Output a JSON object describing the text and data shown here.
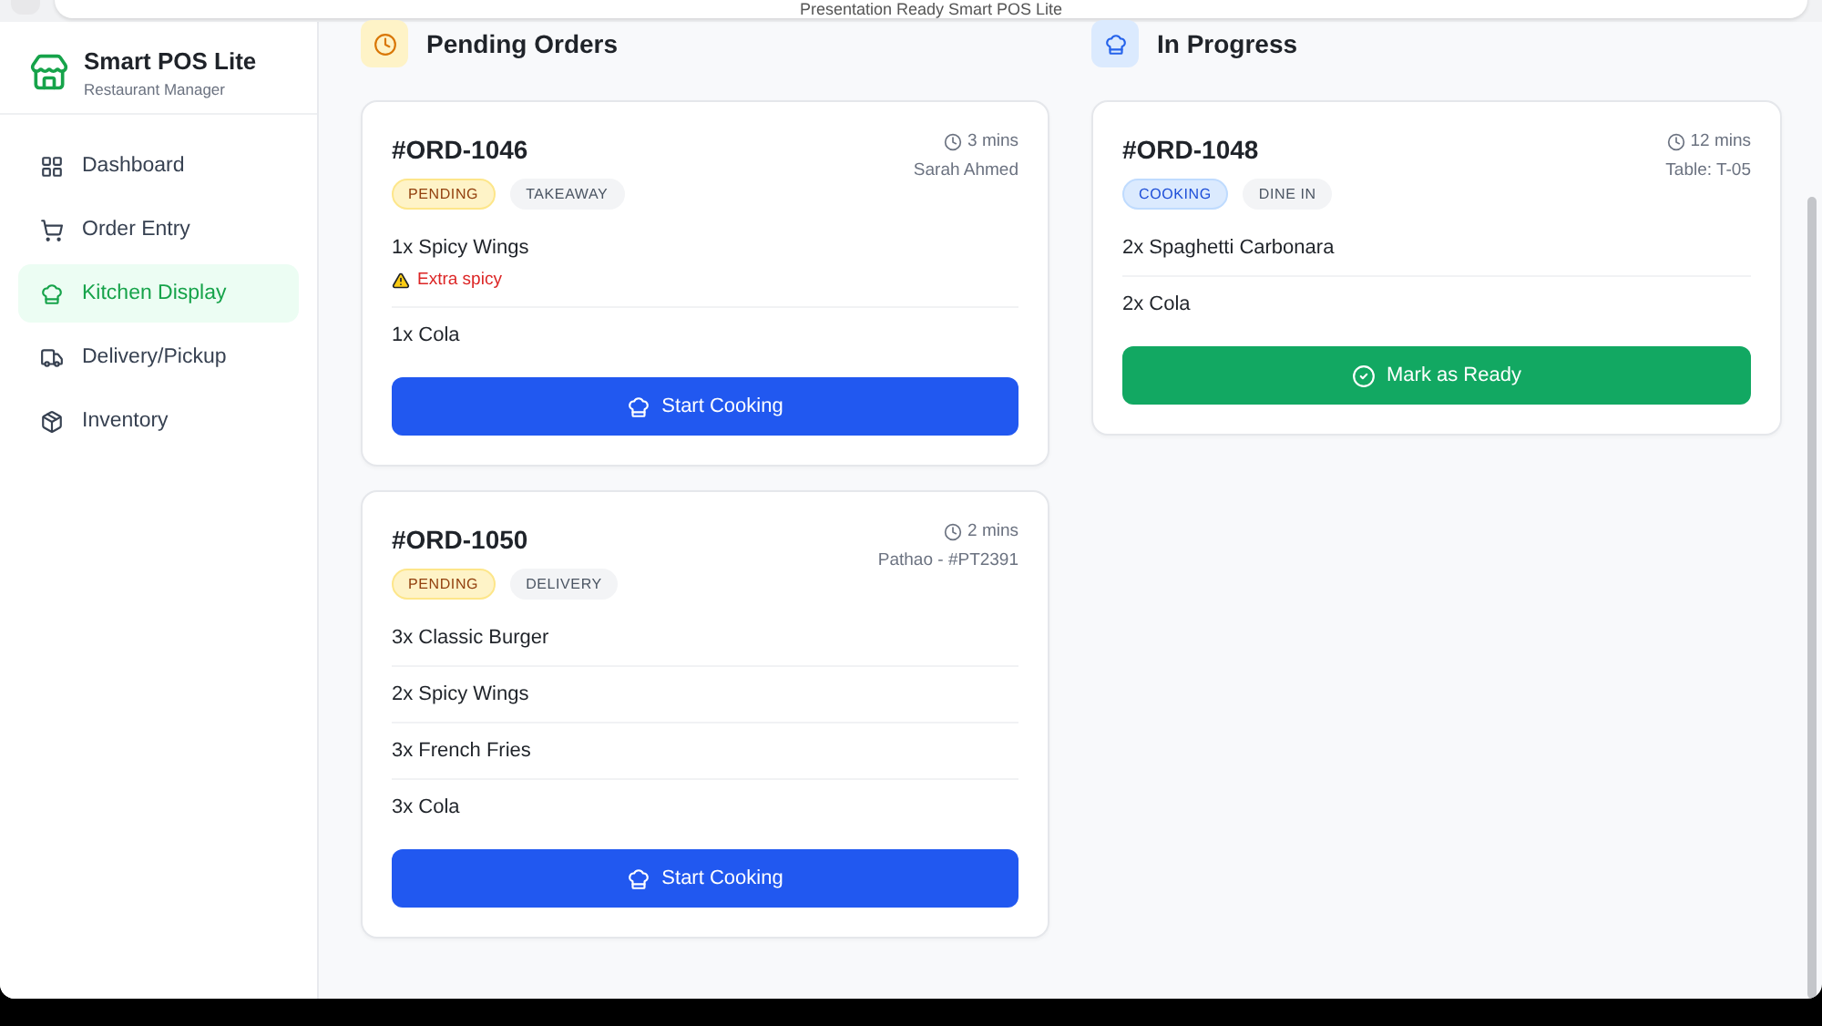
{
  "top_bar": {
    "title": "Presentation Ready Smart POS Lite"
  },
  "sidebar": {
    "app_name": "Smart POS Lite",
    "subtitle": "Restaurant Manager",
    "items": [
      {
        "label": "Dashboard",
        "kind": "grid",
        "selected": false
      },
      {
        "label": "Order Entry",
        "kind": "cart",
        "selected": false
      },
      {
        "label": "Kitchen Display",
        "kind": "chef",
        "selected": true
      },
      {
        "label": "Delivery/Pickup",
        "kind": "truck",
        "selected": false
      },
      {
        "label": "Inventory",
        "kind": "box",
        "selected": false
      }
    ]
  },
  "columns": [
    {
      "title": "Pending Orders",
      "kind": "pending",
      "orders": [
        {
          "id": "#ORD-1046",
          "status": {
            "label": "PENDING",
            "kind": "pending"
          },
          "type": "TAKEAWAY",
          "time": "3 mins",
          "detail": "Sarah Ahmed",
          "items": [
            {
              "text": "1x Spicy Wings",
              "note": "Extra spicy"
            },
            {
              "text": "1x Cola"
            }
          ],
          "action": {
            "label": "Start Cooking",
            "kind": "start"
          }
        },
        {
          "id": "#ORD-1050",
          "status": {
            "label": "PENDING",
            "kind": "pending"
          },
          "type": "DELIVERY",
          "time": "2 mins",
          "detail": "Pathao - #PT2391",
          "items": [
            {
              "text": "3x Classic Burger"
            },
            {
              "text": "2x Spicy Wings"
            },
            {
              "text": "3x French Fries"
            },
            {
              "text": "3x Cola"
            }
          ],
          "action": {
            "label": "Start Cooking",
            "kind": "start"
          }
        }
      ]
    },
    {
      "title": "In Progress",
      "kind": "progress",
      "orders": [
        {
          "id": "#ORD-1048",
          "status": {
            "label": "COOKING",
            "kind": "cooking"
          },
          "type": "DINE IN",
          "time": "12 mins",
          "detail": "Table: T-05",
          "items": [
            {
              "text": "2x Spaghetti Carbonara"
            },
            {
              "text": "2x Cola"
            }
          ],
          "action": {
            "label": "Mark as Ready",
            "kind": "ready"
          }
        }
      ]
    }
  ]
}
